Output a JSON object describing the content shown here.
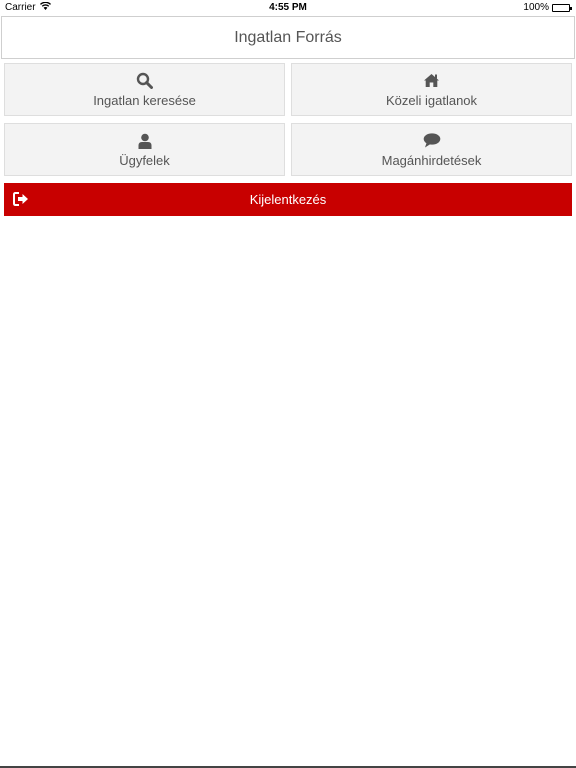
{
  "status_bar": {
    "carrier": "Carrier",
    "time": "4:55 PM",
    "battery": "100%"
  },
  "header": {
    "title": "Ingatlan Forrás"
  },
  "tiles": [
    {
      "label": "Ingatlan keresése",
      "icon": "search-icon"
    },
    {
      "label": "Közeli igatlanok",
      "icon": "home-icon"
    },
    {
      "label": "Ügyfelek",
      "icon": "user-icon"
    },
    {
      "label": "Magánhirdetések",
      "icon": "comment-icon"
    }
  ],
  "logout": {
    "label": "Kijelentkezés",
    "icon": "sign-out-icon",
    "color": "#c80000"
  }
}
